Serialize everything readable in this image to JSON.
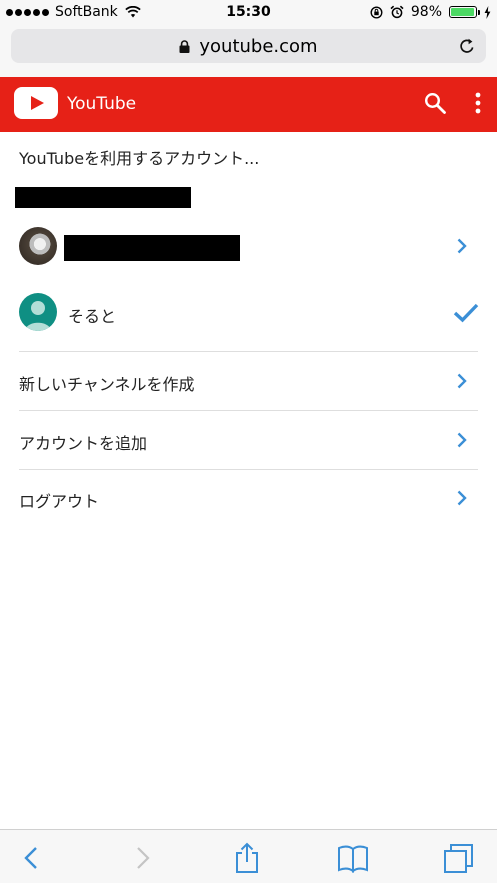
{
  "status_bar": {
    "carrier": "SoftBank",
    "time": "15:30",
    "battery_percent": "98%",
    "battery_level": 0.98
  },
  "browser": {
    "url": "youtube.com"
  },
  "header": {
    "title": "YouTube",
    "brand_color": "#e62117"
  },
  "content": {
    "prompt": "YouTubeを利用するアカウント...",
    "accounts": [
      {
        "name": "",
        "redacted": true,
        "selected": false
      },
      {
        "name": "そると",
        "redacted": false,
        "selected": true
      }
    ],
    "actions": [
      {
        "label": "新しいチャンネルを作成"
      },
      {
        "label": "アカウントを追加"
      },
      {
        "label": "ログアウト"
      }
    ]
  },
  "colors": {
    "accent_blue": "#3b8fd6",
    "avatar_teal": "#0f8f83"
  },
  "icons": [
    "wifi-icon",
    "lock-icon",
    "reload-icon",
    "youtube-logo-icon",
    "search-icon",
    "more-vert-icon",
    "chevron-right-icon",
    "check-icon",
    "back-icon",
    "forward-icon",
    "share-icon",
    "bookmarks-icon",
    "tabs-icon"
  ]
}
